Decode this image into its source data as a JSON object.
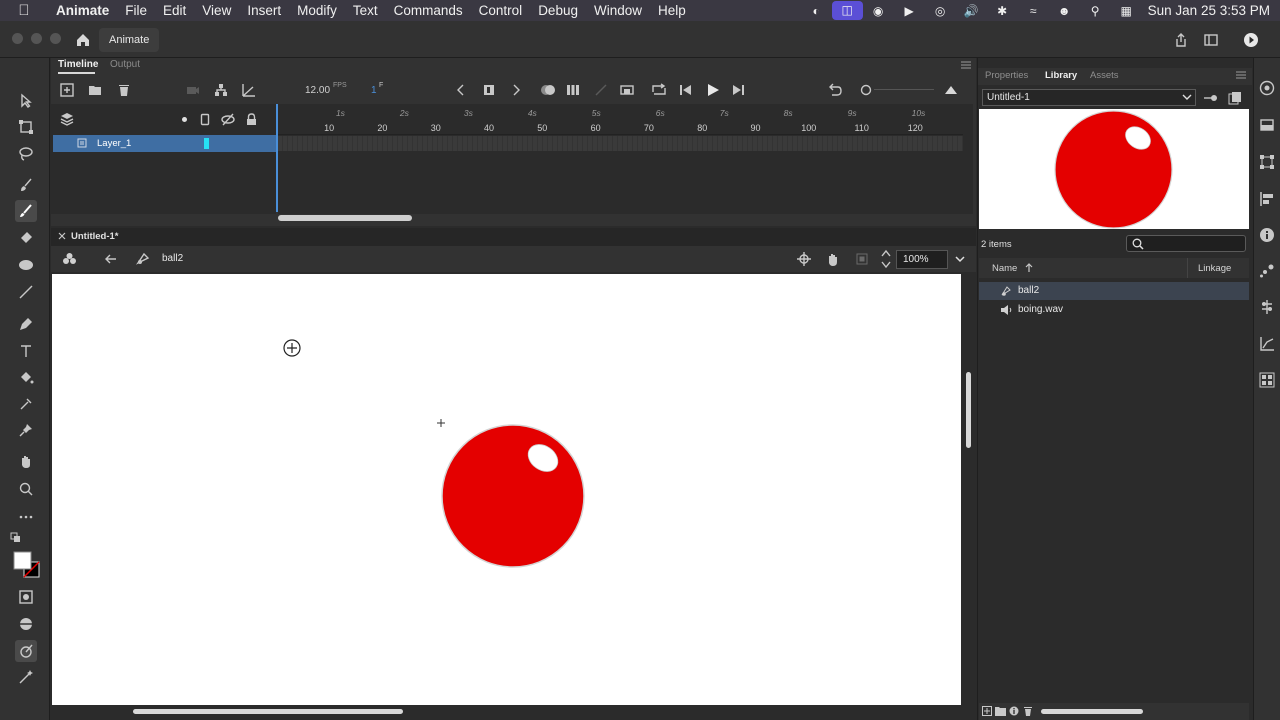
{
  "menubar": {
    "app_name": "Animate",
    "items": [
      "File",
      "Edit",
      "View",
      "Insert",
      "Modify",
      "Text",
      "Commands",
      "Control",
      "Debug",
      "Window",
      "Help"
    ],
    "clock": "Sun Jan 25  3:53 PM"
  },
  "appbar": {
    "document_tab": "Animate"
  },
  "timeline": {
    "tab_timeline": "Timeline",
    "tab_output": "Output",
    "fps_value": "12.00",
    "fps_unit": "FPS",
    "frame_value": "1",
    "frame_unit": "F",
    "frame_numbers": [
      "10",
      "20",
      "30",
      "40",
      "50",
      "60",
      "70",
      "80",
      "90",
      "100",
      "110",
      "120"
    ],
    "second_labels": [
      "1s",
      "2s",
      "3s",
      "4s",
      "5s",
      "6s",
      "7s",
      "8s",
      "9s",
      "10s"
    ],
    "layer_name": "Layer_1"
  },
  "stage": {
    "tab_title": "Untitled-1*",
    "symbol_name": "ball2",
    "zoom": "100%"
  },
  "right_panel": {
    "tab_properties": "Properties",
    "tab_library": "Library",
    "tab_assets": "Assets",
    "library_document": "Untitled-1",
    "items_count": "2 items",
    "col_name": "Name",
    "col_linkage": "Linkage",
    "items": [
      "ball2",
      "boing.wav"
    ]
  },
  "colors": {
    "ball_red": "#e40000",
    "selection_blue": "#3f6ea3",
    "focus_purple": "#5b4fd6"
  }
}
